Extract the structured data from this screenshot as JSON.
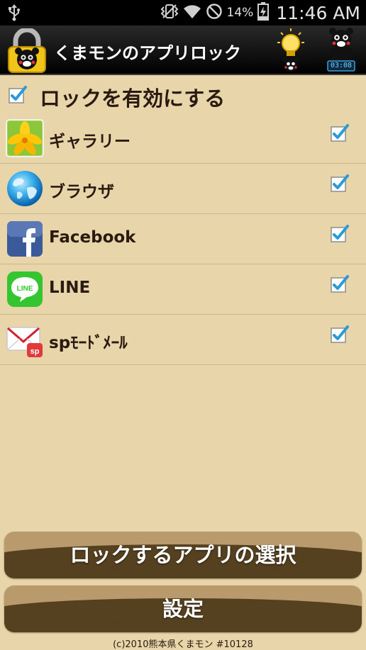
{
  "status_bar": {
    "battery_percent": "14%",
    "time": "11:46 AM",
    "icons": [
      "usb-icon",
      "vibrate-icon",
      "wifi-icon",
      "do-not-disturb-icon",
      "battery-charging-icon"
    ]
  },
  "title_bar": {
    "title": "くまモンのアプリロック",
    "app_icon": "padlock-kumamon-icon",
    "bulb_icon": "lightbulb-kumamon-icon",
    "timer_icon": "kumamon-clock-icon",
    "timer_display": "03:08"
  },
  "enable_lock": {
    "label": "ロックを有効にする",
    "checked": true
  },
  "apps": [
    {
      "label": "ギャラリー",
      "icon": "gallery-icon",
      "checked": true
    },
    {
      "label": "ブラウザ",
      "icon": "browser-icon",
      "checked": true
    },
    {
      "label": "Facebook",
      "icon": "facebook-icon",
      "checked": true
    },
    {
      "label": "LINE",
      "icon": "line-icon",
      "checked": true
    },
    {
      "label": "spﾓｰﾄﾞﾒｰﾙ",
      "icon": "sp-mode-mail-icon",
      "checked": true
    }
  ],
  "buttons": {
    "select_apps": "ロックするアプリの選択",
    "settings": "設定"
  },
  "footer": {
    "copyright": "(c)2010熊本県くまモン #10128"
  },
  "colors": {
    "background": "#e8d5aa",
    "checkbox_check": "#2a9bd6",
    "button_light": "#b89a6d",
    "button_dark": "#55401f"
  }
}
